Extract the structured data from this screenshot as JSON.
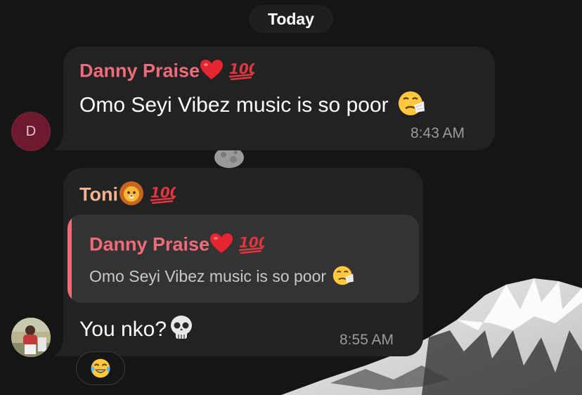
{
  "chat": {
    "date_separator": "Today",
    "messages": [
      {
        "sender": "Danny Praise",
        "sender_badges": [
          "red-heart-icon",
          "hundred-points-icon"
        ],
        "avatar_initial": "D",
        "text": "Omo Seyi Vibez music is so poor",
        "text_emoji": "sneezing-face-icon",
        "time": "8:43 AM"
      },
      {
        "sender": "Toni",
        "sender_badges": [
          "lion-face-icon",
          "hundred-points-icon"
        ],
        "reply_to": {
          "sender": "Danny Praise",
          "text": "Omo Seyi Vibez music is so poor"
        },
        "text": "You nko?",
        "text_emoji": "skull-icon",
        "time": "8:55 AM",
        "reaction": "face-with-tears-of-joy-icon"
      }
    ]
  },
  "colors": {
    "background": "#151515",
    "bubble": "#222222",
    "reply_box": "#333333",
    "danny_name": "#ee6b7a",
    "toni_name": "#f2b48e",
    "timestamp": "#9b9b9b"
  }
}
